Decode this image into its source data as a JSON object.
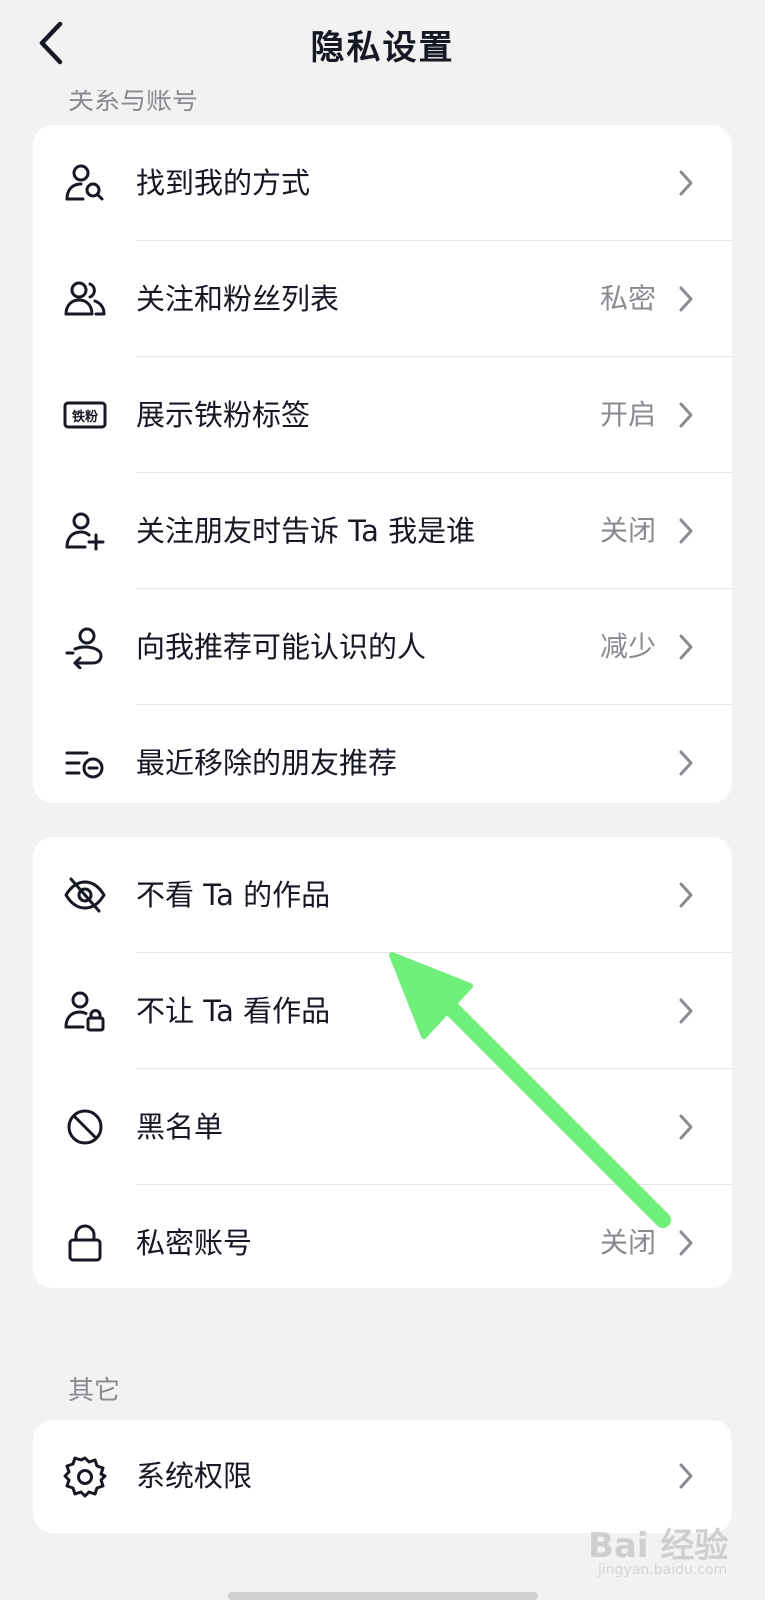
{
  "header": {
    "title": "隐私设置"
  },
  "section_cut_label": "关系与账号",
  "card1": [
    {
      "label": "找到我的方式",
      "value": "",
      "icon": "find-user-icon"
    },
    {
      "label": "关注和粉丝列表",
      "value": "私密",
      "icon": "followers-icon"
    },
    {
      "label": "展示铁粉标签",
      "value": "开启",
      "icon": "tiefen-badge-icon"
    },
    {
      "label": "关注朋友时告诉 Ta 我是谁",
      "value": "关闭",
      "icon": "add-user-icon"
    },
    {
      "label": "向我推荐可能认识的人",
      "value": "减少",
      "icon": "recommend-user-icon"
    },
    {
      "label": "最近移除的朋友推荐",
      "value": "",
      "icon": "removed-list-icon"
    }
  ],
  "card2": [
    {
      "label": "不看 Ta 的作品",
      "value": "",
      "icon": "eye-off-icon"
    },
    {
      "label": "不让 Ta 看作品",
      "value": "",
      "icon": "user-lock-icon"
    },
    {
      "label": "黑名单",
      "value": "",
      "icon": "block-icon"
    },
    {
      "label": "私密账号",
      "value": "关闭",
      "icon": "lock-icon"
    }
  ],
  "section_other": {
    "label": "其它"
  },
  "card3": [
    {
      "label": "系统权限",
      "value": "",
      "icon": "gear-icon"
    }
  ],
  "tiefen_badge_text": "铁粉",
  "watermark": {
    "main": "Bai 经验",
    "sub": "jingyan.baidu.com"
  },
  "colors": {
    "background": "#f2f2f2",
    "card": "#ffffff",
    "text": "#161823",
    "secondary": "#8a8b91",
    "annotation_arrow": "#6ff07a"
  }
}
